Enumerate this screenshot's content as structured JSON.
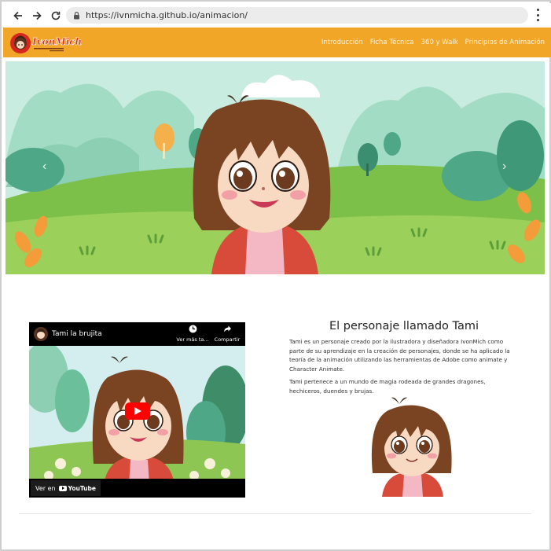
{
  "browser": {
    "url": "https://ivnmicha.github.io/animacion/",
    "back_icon": "back-arrow-icon",
    "forward_icon": "forward-arrow-icon",
    "reload_icon": "reload-icon",
    "lock_icon": "lock-icon",
    "menu_icon": "kebab-menu-icon"
  },
  "header": {
    "logo_text": "IvonMich",
    "nav": [
      "Introducción",
      "Ficha Técnica",
      "360 y Walk",
      "Principios de Animación"
    ],
    "background": "#f2a627"
  },
  "hero": {
    "prev_icon": "chevron-left-icon",
    "next_icon": "chevron-right-icon"
  },
  "video": {
    "title": "Tami la brujita",
    "watch_later": "Ver más ta...",
    "share": "Compartir",
    "watch_on": "Ver en",
    "youtube_label": "YouTube",
    "play_color": "#ff0000"
  },
  "content": {
    "heading": "El personaje llamado Tami",
    "paragraph1": "Tami es un personaje creado por la ilustradora y diseñadora IvonMich como parte de su aprendizaje en la creación de personajes, donde se ha aplicado la teoría de la animación utilizando las herramientas de Adobe como animate y Character Animate.",
    "paragraph2": "Tami pertenece a un mundo de magia rodeada de grandes dragones, hechiceros, duendes y brujas."
  }
}
